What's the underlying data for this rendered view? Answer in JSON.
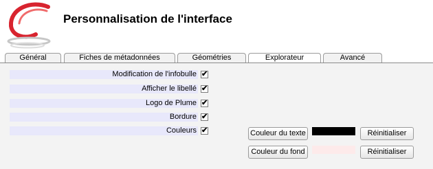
{
  "header": {
    "title": "Personnalisation de l'interface"
  },
  "tabs": [
    {
      "label": "Général",
      "active": false
    },
    {
      "label": "Fiches de métadonnées",
      "active": false
    },
    {
      "label": "Géométries",
      "active": false
    },
    {
      "label": "Explorateur",
      "active": true
    },
    {
      "label": "Avancé",
      "active": false
    }
  ],
  "options": [
    {
      "label": "Modification de l'infobulle",
      "checked": true
    },
    {
      "label": "Afficher le libellé",
      "checked": true
    },
    {
      "label": "Logo de Plume",
      "checked": true
    },
    {
      "label": "Bordure",
      "checked": true
    },
    {
      "label": "Couleurs",
      "checked": true
    }
  ],
  "colors": {
    "text": {
      "button": "Couleur du texte",
      "value": "#000000",
      "reset": "Réinitialiser"
    },
    "background": {
      "button": "Couleur du fond",
      "value": "#fdeaea",
      "reset": "Réinitialiser"
    }
  },
  "check_glyph": "✔"
}
